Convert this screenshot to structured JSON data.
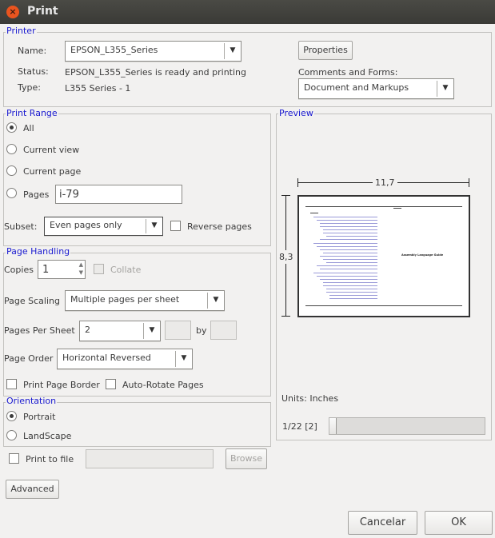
{
  "window": {
    "title": "Print",
    "close_glyph": "×"
  },
  "printer": {
    "legend": "Printer",
    "name_label": "Name:",
    "name_value": "EPSON_L355_Series",
    "properties_button": "Properties",
    "status_label": "Status:",
    "status_value": "EPSON_L355_Series is ready and printing",
    "type_label": "Type:",
    "type_value": "L355 Series -  1",
    "comments_label": "Comments and Forms:",
    "comments_value": "Document and Markups"
  },
  "print_range": {
    "legend": "Print Range",
    "all": "All",
    "current_view": "Current view",
    "current_page": "Current page",
    "pages": "Pages",
    "pages_value": "i-79",
    "subset_label": "Subset:",
    "subset_value": "Even pages only",
    "reverse_pages": "Reverse pages",
    "selected": "all"
  },
  "page_handling": {
    "legend": "Page Handling",
    "copies_label": "Copies",
    "copies_value": "1",
    "collate": "Collate",
    "scaling_label": "Page Scaling",
    "scaling_value": "Multiple pages per sheet",
    "pps_label": "Pages Per Sheet",
    "pps_value": "2",
    "by_label": "by",
    "order_label": "Page Order",
    "order_value": "Horizontal Reversed",
    "print_border": "Print Page Border",
    "auto_rotate": "Auto-Rotate Pages"
  },
  "orientation": {
    "legend": "Orientation",
    "portrait": "Portrait",
    "landscape": "LandScape",
    "selected": "portrait"
  },
  "print_to_file": {
    "label": "Print to file",
    "browse": "Browse"
  },
  "advanced_button": "Advanced",
  "preview": {
    "legend": "Preview",
    "width_label": "11,7",
    "height_label": "8,3",
    "page_title_text": "Assembly Language Guide",
    "units": "Units: Inches",
    "page_indicator": "1/22  [2]"
  },
  "footer": {
    "cancel": "Cancelar",
    "ok": "OK"
  },
  "icons": {
    "dropdown": "▼",
    "spin_up": "▲",
    "spin_down": "▼"
  },
  "colors": {
    "legend_blue": "#1a1ad0",
    "close_orange": "#e9541f",
    "titlebar": "#3d3d39"
  }
}
